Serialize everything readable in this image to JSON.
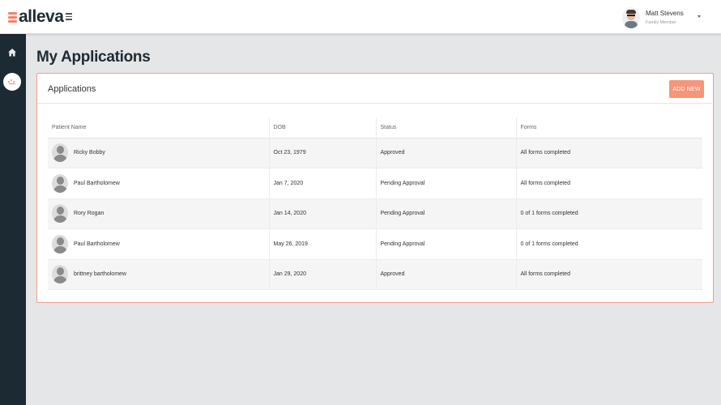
{
  "header": {
    "logo_text": "alleva",
    "user": {
      "name": "Matt Stevens",
      "role": "Family Member"
    }
  },
  "page": {
    "title": "My Applications"
  },
  "panel": {
    "title": "Applications",
    "add_button": "ADD NEW",
    "columns": [
      "Patient Name",
      "DOB",
      "Status",
      "Forms"
    ],
    "rows": [
      {
        "name": "Ricky Bobby",
        "dob": "Oct 23, 1979",
        "status": "Approved",
        "forms": "All forms completed",
        "forms_state": "complete"
      },
      {
        "name": "Paul Bartholomew",
        "dob": "Jan 7, 2020",
        "status": "Pending Approval",
        "forms": "All forms completed",
        "forms_state": "complete"
      },
      {
        "name": "Rory Rogan",
        "dob": "Jan 14, 2020",
        "status": "Pending Approval",
        "forms": "0 of 1 forms completed",
        "forms_state": "incomplete"
      },
      {
        "name": "Paul Bartholomew",
        "dob": "May 26, 2019",
        "status": "Pending Approval",
        "forms": "0 of 1 forms completed",
        "forms_state": "incomplete"
      },
      {
        "name": "brittney bartholomew",
        "dob": "Jan 29, 2020",
        "status": "Approved",
        "forms": "All forms completed",
        "forms_state": "complete"
      }
    ]
  },
  "colors": {
    "accent": "#f5957a",
    "sidebar": "#1c2a33",
    "complete": "#4c9a2a",
    "incomplete": "#f0926f"
  },
  "icons": {
    "menu": "hamburger-icon",
    "home": "home-icon",
    "applications": "applications-icon",
    "avatar": "person-silhouette-icon"
  }
}
